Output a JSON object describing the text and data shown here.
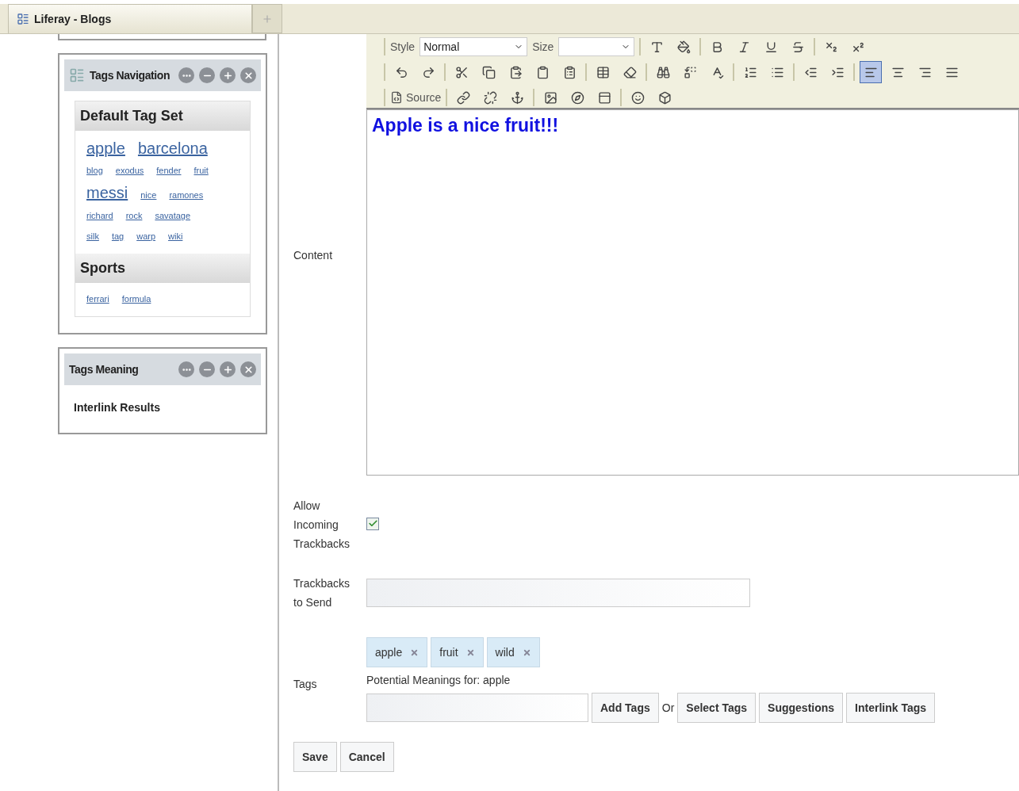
{
  "browser_tab": {
    "title": "Liferay - Blogs"
  },
  "tags_navigation": {
    "title": "Tags Navigation",
    "sets": [
      {
        "name": "Default Tag Set",
        "tags": [
          {
            "label": "apple",
            "kind": "large"
          },
          {
            "label": "barcelona",
            "kind": "large"
          },
          {
            "label": "blog",
            "kind": "small"
          },
          {
            "label": "exodus",
            "kind": "small"
          },
          {
            "label": "fender",
            "kind": "small"
          },
          {
            "label": "fruit",
            "kind": "small"
          },
          {
            "label": "messi",
            "kind": "large"
          },
          {
            "label": "nice",
            "kind": "small"
          },
          {
            "label": "ramones",
            "kind": "small"
          },
          {
            "label": "richard",
            "kind": "small"
          },
          {
            "label": "rock",
            "kind": "small"
          },
          {
            "label": "savatage",
            "kind": "small"
          },
          {
            "label": "silk",
            "kind": "small"
          },
          {
            "label": "tag",
            "kind": "small"
          },
          {
            "label": "warp",
            "kind": "small"
          },
          {
            "label": "wiki",
            "kind": "small"
          }
        ]
      },
      {
        "name": "Sports",
        "tags": [
          {
            "label": "ferrari",
            "kind": "small"
          },
          {
            "label": "formula",
            "kind": "small"
          }
        ]
      }
    ]
  },
  "tags_meaning": {
    "title": "Tags Meaning",
    "body": "Interlink Results"
  },
  "editor": {
    "label": "Content",
    "style_label": "Style",
    "style_value": "Normal",
    "size_label": "Size",
    "source_label": "Source",
    "align_buttons": [
      {
        "selected": true
      },
      {
        "selected": false
      },
      {
        "selected": false
      },
      {
        "selected": false
      }
    ],
    "text": "Apple is a nice fruit!!!"
  },
  "trackbacks": {
    "label_lines": [
      "Allow",
      "Incoming",
      "Trackbacks"
    ],
    "checked": true
  },
  "trackbacks_to_send": {
    "label_lines": [
      "Trackbacks",
      "to Send"
    ]
  },
  "tags": {
    "label": "Tags",
    "chips": [
      "apple",
      "fruit",
      "wild"
    ],
    "meanings": "Potential Meanings for: apple",
    "add_button": "Add Tags",
    "or": "Or",
    "buttons": [
      "Select Tags",
      "Suggestions",
      "Interlink Tags"
    ]
  },
  "actions": [
    "Save",
    "Cancel"
  ]
}
